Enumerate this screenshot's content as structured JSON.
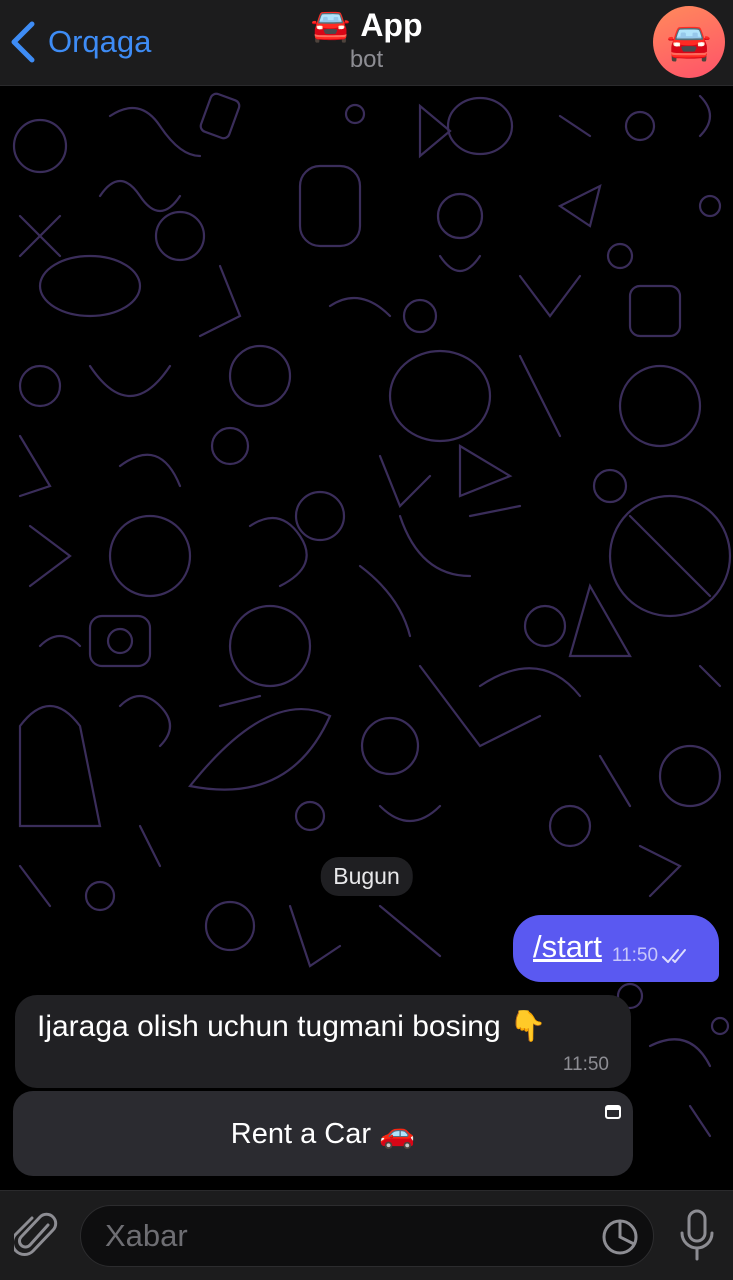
{
  "header": {
    "back_label": "Orqaga",
    "title": "App",
    "title_emoji": "🚘",
    "subtitle": "bot",
    "avatar_emoji": "🚘"
  },
  "chat": {
    "date_label": "Bugun",
    "messages": [
      {
        "direction": "outgoing",
        "text": "/start",
        "time": "11:50",
        "status": "read"
      },
      {
        "direction": "incoming",
        "text": "Ijaraga olish uchun tugmani bosing 👇",
        "time": "11:50"
      }
    ],
    "inline_button": {
      "label": "Rent a Car 🚗",
      "icon": "web-app-icon"
    }
  },
  "input": {
    "placeholder": "Xabar",
    "icons": [
      "paperclip-icon",
      "sticker-icon",
      "microphone-icon"
    ]
  },
  "colors": {
    "accent": "#3e8cf5",
    "outgoing_bubble": "#5a59f1",
    "incoming_bubble": "#212124",
    "button": "#2b2b30"
  }
}
